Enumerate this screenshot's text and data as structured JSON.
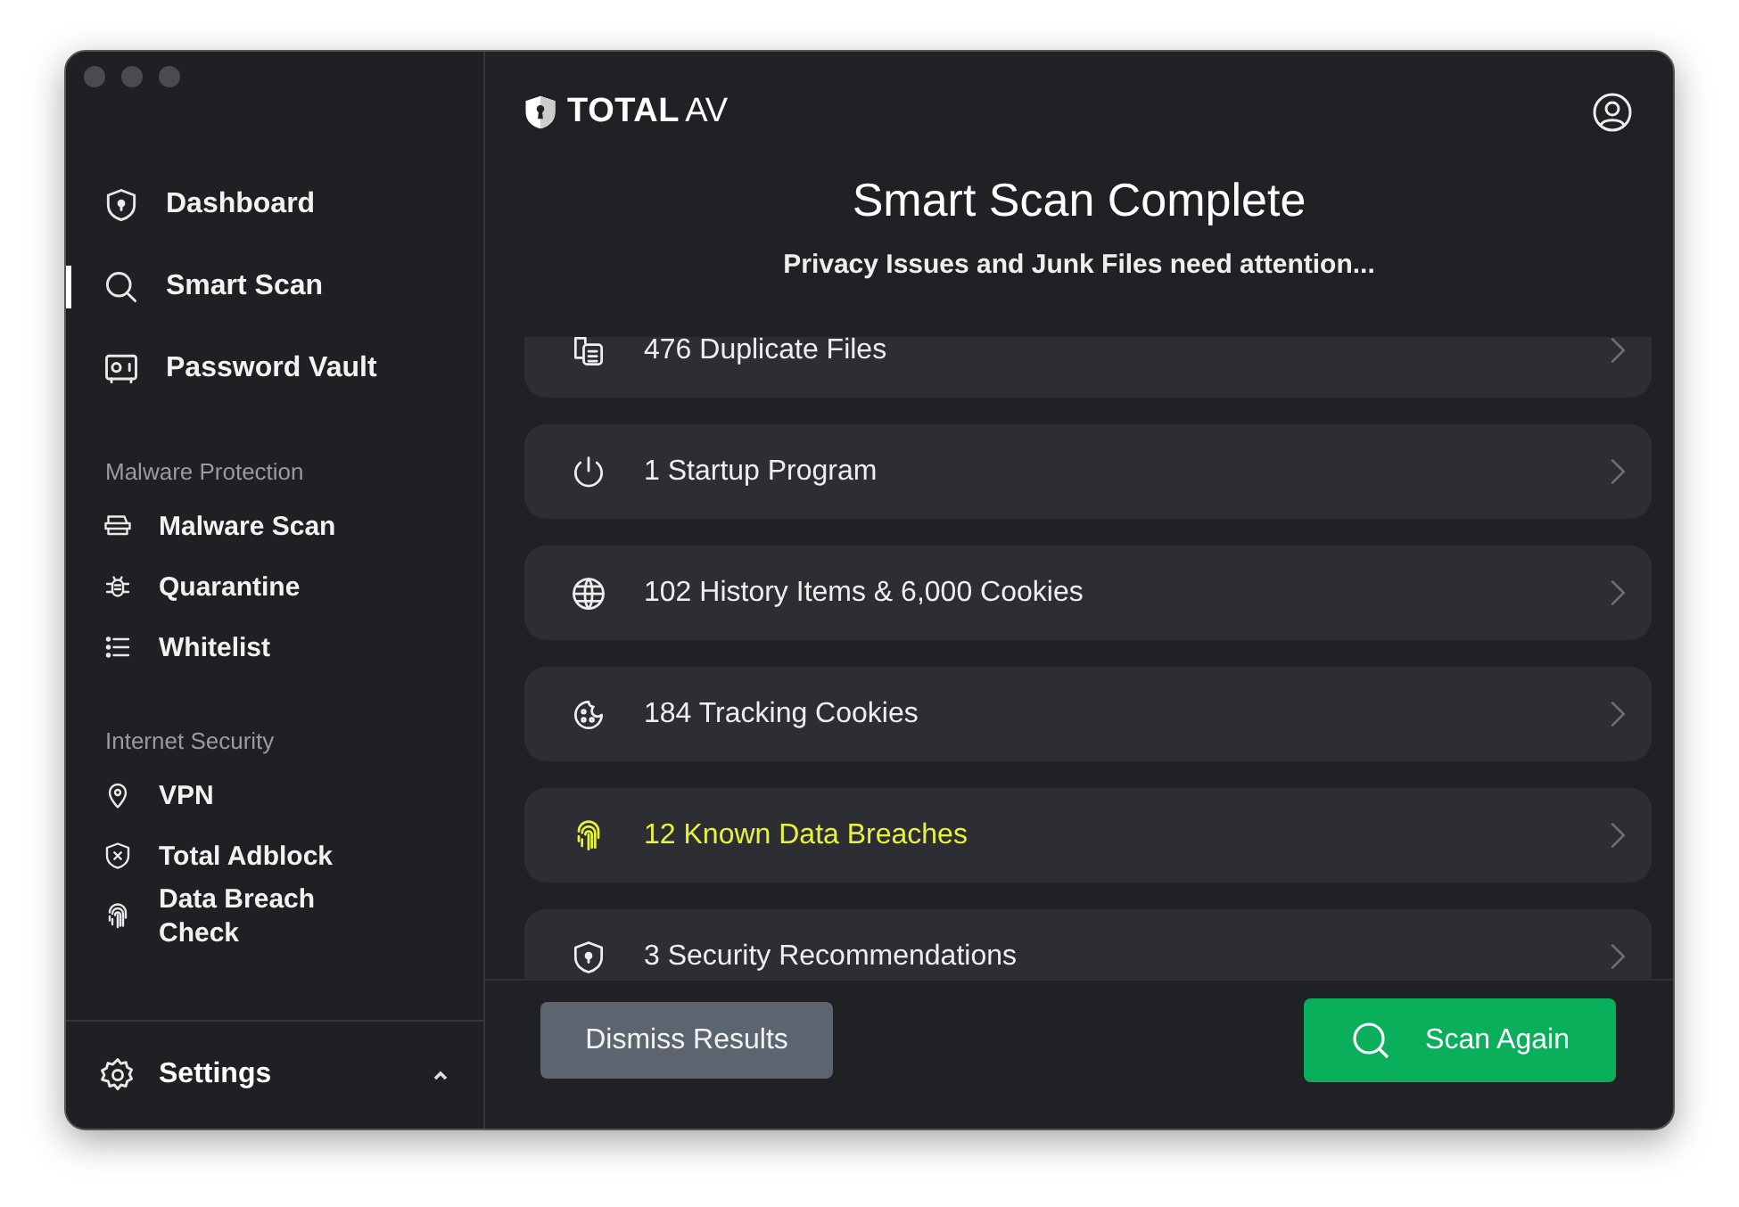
{
  "sidebar": {
    "items": [
      {
        "label": "Dashboard",
        "kind": "shield",
        "selected": false
      },
      {
        "label": "Smart Scan",
        "kind": "search",
        "selected": true
      },
      {
        "label": "Password Vault",
        "kind": "safe",
        "selected": false
      }
    ],
    "sections": [
      {
        "heading": "Malware Protection",
        "items": [
          {
            "label": "Malware Scan",
            "kind": "scanner"
          },
          {
            "label": "Quarantine",
            "kind": "bug"
          },
          {
            "label": "Whitelist",
            "kind": "list"
          }
        ]
      },
      {
        "heading": "Internet Security",
        "items": [
          {
            "label": "VPN",
            "kind": "pin"
          },
          {
            "label": "Total Adblock",
            "kind": "shieldx"
          },
          {
            "label": "Data Breach Check",
            "kind": "finger"
          }
        ]
      }
    ],
    "settings": {
      "label": "Settings",
      "expanded": true
    }
  },
  "brand": {
    "strong": "TOTAL",
    "light": "AV"
  },
  "title": "Smart Scan Complete",
  "subtitle": "Privacy Issues and Junk Files need attention...",
  "results": [
    {
      "label": "476 Duplicate Files",
      "kind": "files",
      "highlighted": false
    },
    {
      "label": "1 Startup Program",
      "kind": "power",
      "highlighted": false
    },
    {
      "label": "102 History Items & 6,000 Cookies",
      "kind": "globe",
      "highlighted": false
    },
    {
      "label": "184 Tracking Cookies",
      "kind": "cookie",
      "highlighted": false
    },
    {
      "label": "12 Known Data Breaches",
      "kind": "finger",
      "highlighted": true
    },
    {
      "label": "3 Security Recommendations",
      "kind": "shield",
      "highlighted": false
    }
  ],
  "buttons": {
    "dismiss": "Dismiss Results",
    "scan": "Scan Again"
  }
}
